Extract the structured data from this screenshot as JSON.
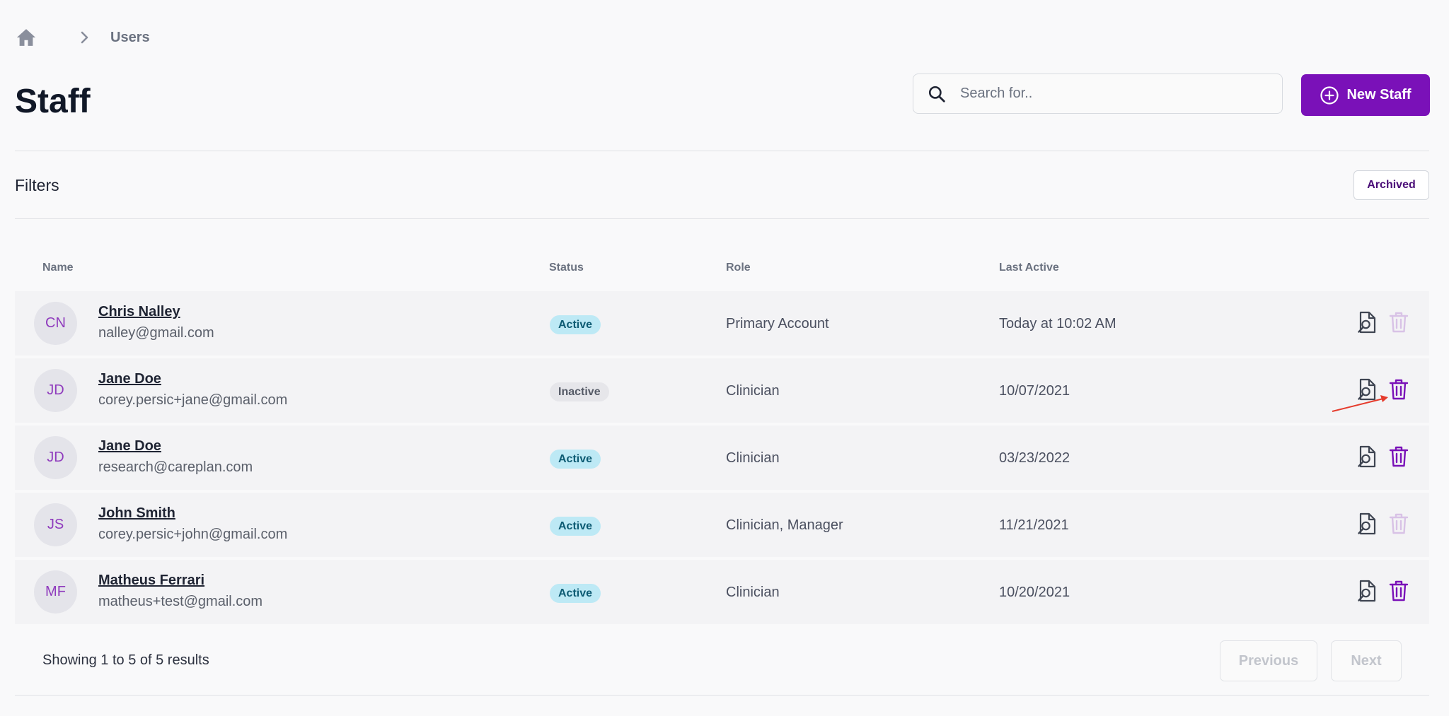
{
  "breadcrumb": {
    "home_icon": "home-icon",
    "separator_icon": "chevron-right-icon",
    "current": "Users"
  },
  "page": {
    "title": "Staff"
  },
  "search": {
    "placeholder": "Search for..",
    "value": "",
    "icon": "search-icon"
  },
  "actions": {
    "new_staff_label": "New Staff",
    "new_staff_icon": "plus-circle-icon"
  },
  "filters": {
    "title": "Filters",
    "archived_label": "Archived"
  },
  "table": {
    "headers": {
      "name": "Name",
      "status": "Status",
      "role": "Role",
      "last_active": "Last Active"
    },
    "rows": [
      {
        "initials": "CN",
        "name": "Chris Nalley",
        "email": "nalley@gmail.com",
        "status": "Active",
        "role": "Primary Account",
        "last_active": "Today at 10:02 AM",
        "delete_enabled": false
      },
      {
        "initials": "JD",
        "name": "Jane Doe",
        "email": "corey.persic+jane@gmail.com",
        "status": "Inactive",
        "role": "Clinician",
        "last_active": "10/07/2021",
        "delete_enabled": true
      },
      {
        "initials": "JD",
        "name": "Jane Doe",
        "email": "research@careplan.com",
        "status": "Active",
        "role": "Clinician",
        "last_active": "03/23/2022",
        "delete_enabled": true
      },
      {
        "initials": "JS",
        "name": "John Smith",
        "email": "corey.persic+john@gmail.com",
        "status": "Active",
        "role": "Clinician, Manager",
        "last_active": "11/21/2021",
        "delete_enabled": false
      },
      {
        "initials": "MF",
        "name": "Matheus Ferrari",
        "email": "matheus+test@gmail.com",
        "status": "Active",
        "role": "Clinician",
        "last_active": "10/20/2021",
        "delete_enabled": true
      }
    ]
  },
  "pagination": {
    "summary": "Showing 1 to 5 of 5 results",
    "previous_label": "Previous",
    "next_label": "Next"
  },
  "colors": {
    "accent": "#7a11b8",
    "delete_enabled": "#7a11b8",
    "delete_disabled": "#d8c2e6",
    "active_badge": "#bde9f5",
    "inactive_badge": "#e6e6ea",
    "annotation_arrow": "#e53b2c"
  }
}
